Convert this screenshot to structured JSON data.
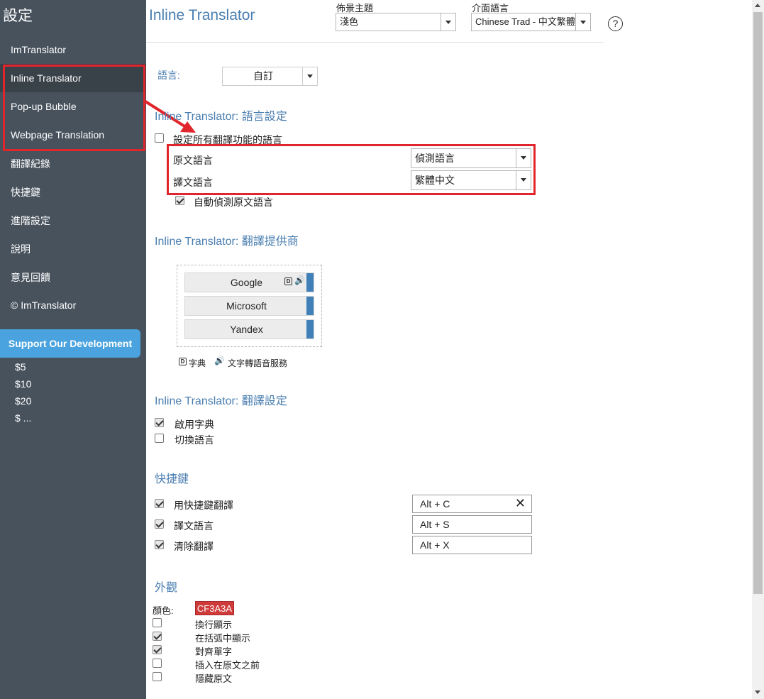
{
  "sidebar": {
    "title": "設定",
    "items": [
      {
        "label": "ImTranslator"
      },
      {
        "label": "Inline Translator"
      },
      {
        "label": "Pop-up Bubble"
      },
      {
        "label": "Webpage Translation"
      },
      {
        "label": "翻譯紀錄"
      },
      {
        "label": "快捷鍵"
      },
      {
        "label": "進階設定"
      },
      {
        "label": "說明"
      },
      {
        "label": "意見回饋"
      },
      {
        "label": "© ImTranslator"
      }
    ],
    "support_label": "Support Our Development",
    "donations": [
      "$5",
      "$10",
      "$20",
      "$ ..."
    ]
  },
  "header": {
    "title": "Inline Translator",
    "theme_label": "佈景主題",
    "theme_value": "淺色",
    "ui_lang_label": "介面語言",
    "ui_lang_value": "Chinese Trad - 中文繁體",
    "help": "?"
  },
  "language": {
    "label": "語言:",
    "value": "自訂"
  },
  "lang_settings": {
    "title": "Inline Translator: 語言設定",
    "set_all_label": "設定所有翻譯功能的語言",
    "set_all_checked": false,
    "source_label": "原文語言",
    "source_value": "偵測語言",
    "target_label": "譯文語言",
    "target_value": "繁體中文",
    "autodetect_label": "自動偵測原文語言",
    "autodetect_checked": true
  },
  "providers": {
    "title": "Inline Translator: 翻譯提供商",
    "items": [
      {
        "name": "Google",
        "has_dict": true,
        "has_tts": true
      },
      {
        "name": "Microsoft"
      },
      {
        "name": "Yandex"
      }
    ],
    "legend_dict": "字典",
    "legend_tts": "文字轉語音服務",
    "dict_glyph": "D",
    "tts_glyph": "🔊"
  },
  "translate_settings": {
    "title": "Inline Translator: 翻譯設定",
    "enable_dict_label": "啟用字典",
    "enable_dict_checked": true,
    "switch_lang_label": "切換語言",
    "switch_lang_checked": false
  },
  "shortcuts": {
    "title": "快捷鍵",
    "items": [
      {
        "label": "用快捷鍵翻譯",
        "checked": true,
        "value": "Alt + C",
        "clear": "✕"
      },
      {
        "label": "譯文語言",
        "checked": true,
        "value": "Alt + S"
      },
      {
        "label": "清除翻譯",
        "checked": true,
        "value": "Alt + X"
      }
    ]
  },
  "appearance": {
    "title": "外觀",
    "color_label": "顏色:",
    "color_value": "CF3A3A",
    "color_hex": "#cf3a3a",
    "options": [
      {
        "label": "換行顯示",
        "checked": false
      },
      {
        "label": "在括弧中顯示",
        "checked": true
      },
      {
        "label": "對齊單字",
        "checked": true
      },
      {
        "label": "插入在原文之前",
        "checked": false
      },
      {
        "label": "隱藏原文",
        "checked": false
      }
    ]
  }
}
